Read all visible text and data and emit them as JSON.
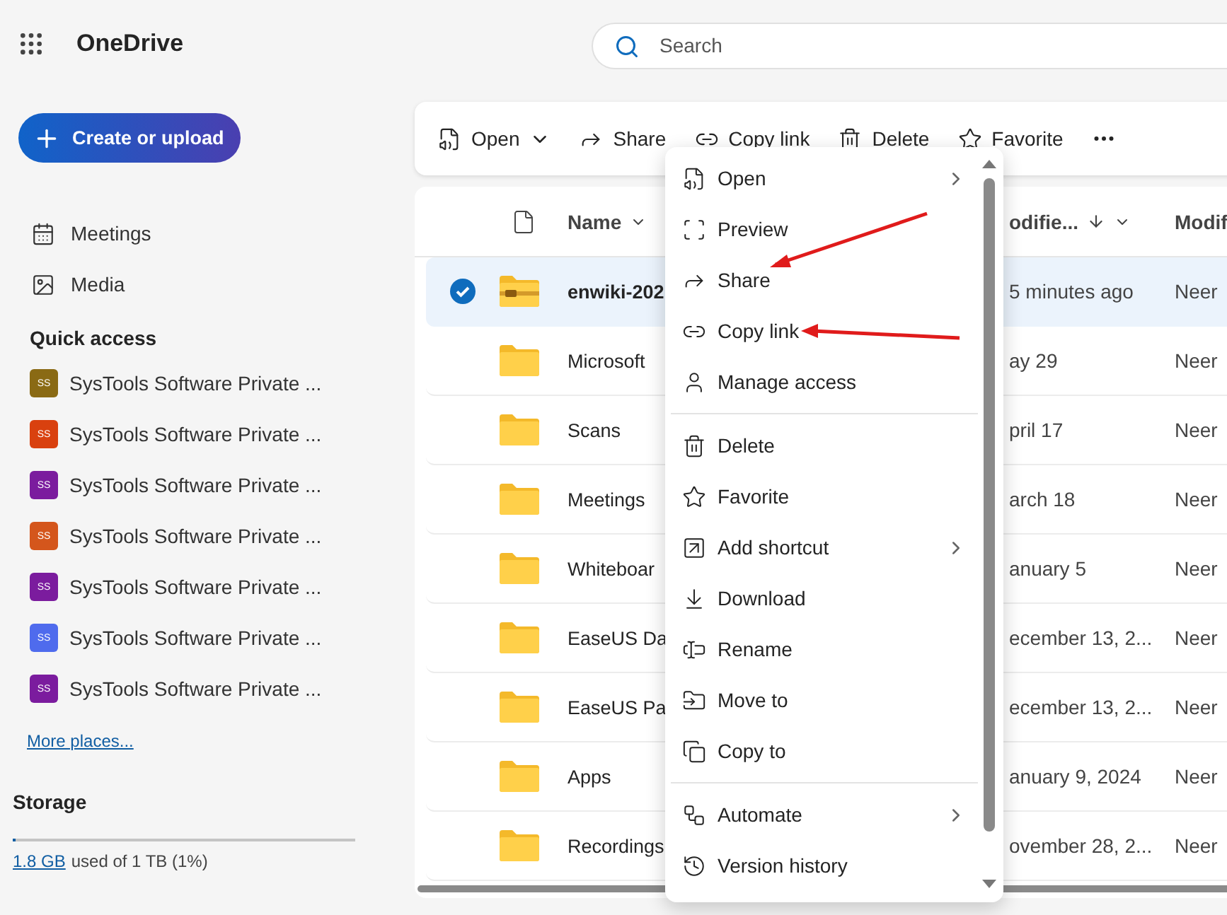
{
  "app": {
    "title": "OneDrive"
  },
  "search": {
    "placeholder": "Search"
  },
  "create_button": {
    "label": "Create or upload"
  },
  "nav": [
    {
      "label": "Meetings"
    },
    {
      "label": "Media"
    }
  ],
  "quick_access": {
    "title": "Quick access",
    "items": [
      {
        "badge": "SS",
        "label": "SysTools Software Private ...",
        "color": "#8a6a14"
      },
      {
        "badge": "SS",
        "label": "SysTools Software Private ...",
        "color": "#d9410f"
      },
      {
        "badge": "SS",
        "label": "SysTools Software Private ...",
        "color": "#7b1c9e"
      },
      {
        "badge": "SS",
        "label": "SysTools Software Private ...",
        "color": "#d4561c"
      },
      {
        "badge": "SS",
        "label": "SysTools Software Private ...",
        "color": "#7b1c9e"
      },
      {
        "badge": "SS",
        "label": "SysTools Software Private ...",
        "color": "#4f6bed"
      },
      {
        "badge": "SS",
        "label": "SysTools Software Private ...",
        "color": "#7b1c9e"
      }
    ],
    "more": "More places..."
  },
  "storage": {
    "title": "Storage",
    "used": "1.8 GB",
    "detail": "used of 1 TB (1%)",
    "level": 0.01
  },
  "toolbar": [
    {
      "label": "Open",
      "dropdown": true
    },
    {
      "label": "Share",
      "dropdown": false
    },
    {
      "label": "Copy link",
      "dropdown": false
    },
    {
      "label": "Delete",
      "dropdown": false
    },
    {
      "label": "Favorite",
      "dropdown": false
    }
  ],
  "table": {
    "columns": [
      "Name",
      "odifie...",
      "Modif"
    ],
    "rows": [
      {
        "kind": "zip",
        "name": "enwiki-202",
        "modified": "5 minutes ago",
        "modified_by": "Neer",
        "selected": true
      },
      {
        "kind": "folder",
        "name": "Microsoft",
        "modified": "ay 29",
        "modified_by": "Neer",
        "selected": false
      },
      {
        "kind": "folder",
        "name": "Scans",
        "modified": "pril 17",
        "modified_by": "Neer",
        "selected": false
      },
      {
        "kind": "folder",
        "name": "Meetings",
        "modified": "arch 18",
        "modified_by": "Neer",
        "selected": false
      },
      {
        "kind": "folder",
        "name": "Whiteboar",
        "modified": "anuary 5",
        "modified_by": "Neer",
        "selected": false
      },
      {
        "kind": "folder",
        "name": "EaseUS Da",
        "modified": "ecember 13, 2...",
        "modified_by": "Neer",
        "selected": false
      },
      {
        "kind": "folder",
        "name": "EaseUS Pa",
        "modified": "ecember 13, 2...",
        "modified_by": "Neer",
        "selected": false
      },
      {
        "kind": "folder",
        "name": "Apps",
        "modified": "anuary 9, 2024",
        "modified_by": "Neer",
        "selected": false
      },
      {
        "kind": "folder",
        "name": "Recordings",
        "modified": "ovember 28, 2...",
        "modified_by": "Neer",
        "selected": false
      }
    ]
  },
  "context_menu": {
    "groups": [
      [
        {
          "label": "Open",
          "submenu": true
        },
        {
          "label": "Preview",
          "submenu": false
        },
        {
          "label": "Share",
          "submenu": false
        },
        {
          "label": "Copy link",
          "submenu": false
        },
        {
          "label": "Manage access",
          "submenu": false
        }
      ],
      [
        {
          "label": "Delete",
          "submenu": false
        },
        {
          "label": "Favorite",
          "submenu": false
        },
        {
          "label": "Add shortcut",
          "submenu": true
        },
        {
          "label": "Download",
          "submenu": false
        },
        {
          "label": "Rename",
          "submenu": false
        },
        {
          "label": "Move to",
          "submenu": false
        },
        {
          "label": "Copy to",
          "submenu": false
        }
      ],
      [
        {
          "label": "Automate",
          "submenu": true
        },
        {
          "label": "Version history",
          "submenu": false
        }
      ]
    ]
  }
}
